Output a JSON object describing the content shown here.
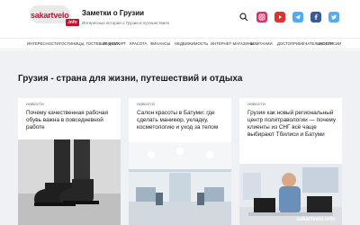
{
  "header": {
    "logo_text": "sakartvelo",
    "logo_badge": ".info",
    "site_title": "Заметки о Грузии",
    "site_subtitle": "Интересные истории о Грузии и путешествиях",
    "icons": [
      "search-icon",
      "instagram-icon",
      "youtube-icon",
      "telegram-icon",
      "facebook-icon",
      "twitter-icon"
    ]
  },
  "nav": {
    "items": [
      {
        "label": "Интересности"
      },
      {
        "label": "Гостиницы, гостевые дома"
      },
      {
        "label": "Транспорт"
      },
      {
        "label": "Красота"
      },
      {
        "label": "Финансы"
      },
      {
        "label": "Недвижимость"
      },
      {
        "label": "Интернет-магазины"
      },
      {
        "label": "Компании"
      },
      {
        "label": "Достопримечательности"
      },
      {
        "label": "Экскурсии"
      }
    ]
  },
  "main": {
    "section_title": "Грузия - страна для жизни, путешествий и отдыха",
    "cards": [
      {
        "category": "Новости",
        "title": "Почему качественная рабочая обувь важна в повседневной работе"
      },
      {
        "category": "Новости",
        "title": "Салон красоты в Батуми: где сделать маникюр, укладку, косметологию и уход за телом"
      },
      {
        "category": "Новости",
        "title": "Грузия как новый региональный центр политравологии — почему клиенты из СНГ всё чаще выбирают Тбилиси и Батуми"
      }
    ],
    "watermark": "sakartvelo.info"
  },
  "colors": {
    "brand": "#c8102e",
    "page_bg": "#eff1f4"
  }
}
